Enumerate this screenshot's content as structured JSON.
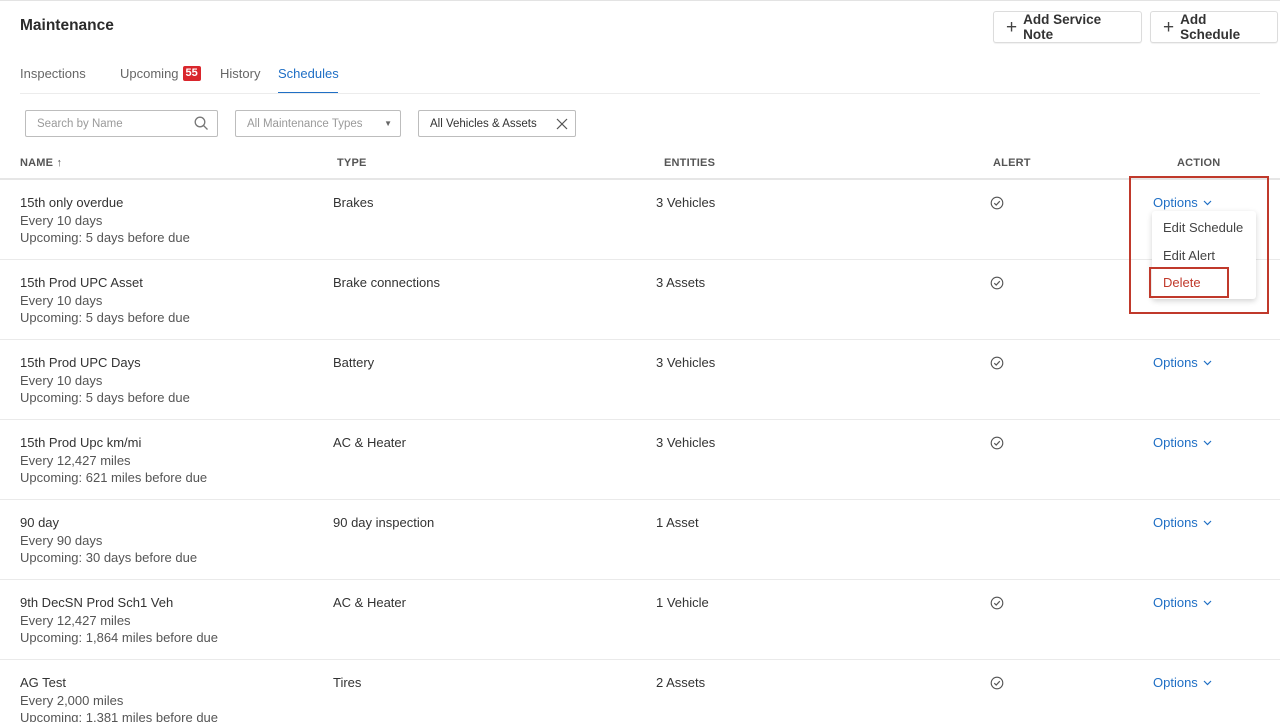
{
  "header": {
    "title": "Maintenance",
    "add_service_note": "Add Service Note",
    "add_schedule": "Add Schedule"
  },
  "tabs": [
    {
      "label": "Inspections"
    },
    {
      "label": "Upcoming",
      "badge": "55"
    },
    {
      "label": "History"
    },
    {
      "label": "Schedules",
      "active": true
    }
  ],
  "filters": {
    "search_placeholder": "Search by Name",
    "types_placeholder": "All Maintenance Types",
    "vehicles_value": "All Vehicles & Assets"
  },
  "table": {
    "columns": {
      "name": "NAME",
      "sort_glyph": "↑",
      "type": "TYPE",
      "entities": "ENTITIES",
      "alert": "ALERT",
      "action": "ACTION"
    },
    "rows": [
      {
        "name": "15th only overdue",
        "interval": "Every 10 days",
        "upcoming": "Upcoming: 5 days before due",
        "type": "Brakes",
        "entities": "3 Vehicles",
        "alert": true,
        "action": "Options"
      },
      {
        "name": "15th Prod UPC Asset",
        "interval": "Every 10 days",
        "upcoming": "Upcoming: 5 days before due",
        "type": "Brake connections",
        "entities": "3 Assets",
        "alert": true,
        "action": "Options"
      },
      {
        "name": "15th Prod UPC Days",
        "interval": "Every 10 days",
        "upcoming": "Upcoming: 5 days before due",
        "type": "Battery",
        "entities": "3 Vehicles",
        "alert": true,
        "action": "Options"
      },
      {
        "name": "15th Prod Upc km/mi",
        "interval": "Every 12,427 miles",
        "upcoming": "Upcoming: 621 miles before due",
        "type": "AC & Heater",
        "entities": "3 Vehicles",
        "alert": true,
        "action": "Options"
      },
      {
        "name": "90 day",
        "interval": "Every 90 days",
        "upcoming": "Upcoming: 30 days before due",
        "type": "90 day inspection",
        "entities": "1 Asset",
        "alert": false,
        "action": "Options"
      },
      {
        "name": "9th DecSN Prod Sch1 Veh",
        "interval": "Every 12,427 miles",
        "upcoming": "Upcoming: 1,864 miles before due",
        "type": "AC & Heater",
        "entities": "1 Vehicle",
        "alert": true,
        "action": "Options"
      },
      {
        "name": "AG Test",
        "interval": "Every 2,000 miles",
        "upcoming": "Upcoming: 1,381 miles before due",
        "type": "Tires",
        "entities": "2 Assets",
        "alert": true,
        "action": "Options"
      }
    ]
  },
  "options_menu": {
    "edit_schedule": "Edit Schedule",
    "edit_alert": "Edit Alert",
    "delete": "Delete"
  },
  "colors": {
    "accent": "#1f6fc5",
    "badge": "#d9262c",
    "highlight": "#c0392b"
  }
}
